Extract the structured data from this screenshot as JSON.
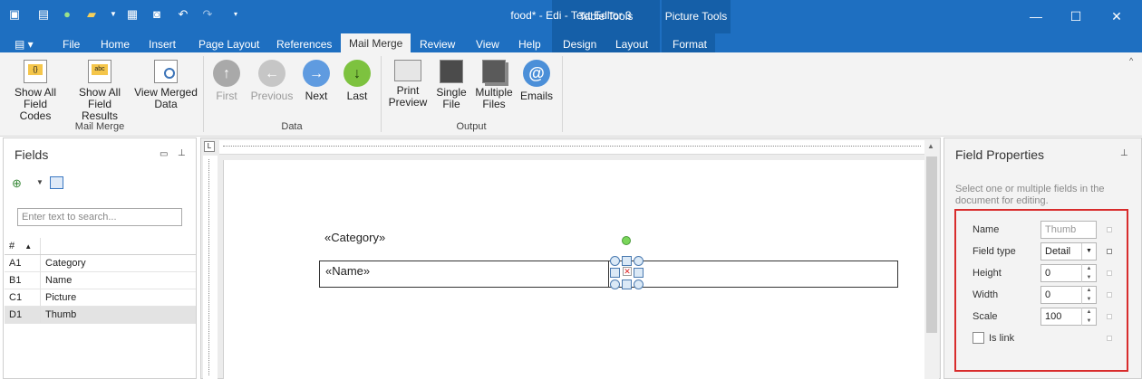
{
  "window": {
    "title": "food* - Edi - Text Editor 3"
  },
  "context_groups": {
    "table_tools": "Table Tools",
    "picture_tools": "Picture Tools"
  },
  "tabs": {
    "file": "File",
    "home": "Home",
    "insert": "Insert",
    "page_layout": "Page Layout",
    "references": "References",
    "mail_merge": "Mail Merge",
    "review": "Review",
    "view": "View",
    "help": "Help",
    "design": "Design",
    "layout": "Layout",
    "format": "Format"
  },
  "ribbon": {
    "show_all_field_codes": "Show All\nField Codes",
    "show_all_field_results": "Show All\nField Results",
    "view_merged_data": "View Merged\nData",
    "group_mail_merge": "Mail Merge",
    "first": "First",
    "previous": "Previous",
    "next": "Next",
    "last": "Last",
    "group_data": "Data",
    "print_preview": "Print\nPreview",
    "single_file": "Single\nFile",
    "multiple_files": "Multiple\nFiles",
    "emails": "Emails",
    "group_output": "Output"
  },
  "fields_panel": {
    "title": "Fields",
    "search_placeholder": "Enter text to search...",
    "col_id": "#",
    "rows": [
      {
        "id": "A1",
        "name": "Category"
      },
      {
        "id": "B1",
        "name": "Name"
      },
      {
        "id": "C1",
        "name": "Picture"
      },
      {
        "id": "D1",
        "name": "Thumb"
      }
    ]
  },
  "document": {
    "category_field": "«Category»",
    "name_field": "«Name»"
  },
  "properties_panel": {
    "title": "Field Properties",
    "hint": "Select one or multiple fields in the document for editing.",
    "name_label": "Name",
    "name_value": "Thumb",
    "type_label": "Field type",
    "type_value": "Detail",
    "height_label": "Height",
    "height_value": "0",
    "width_label": "Width",
    "width_value": "0",
    "scale_label": "Scale",
    "scale_value": "100",
    "islink_label": "Is link"
  },
  "colors": {
    "titlebar": "#1e6fc1",
    "context": "#155fa8",
    "highlight_border": "#d82c2c"
  }
}
